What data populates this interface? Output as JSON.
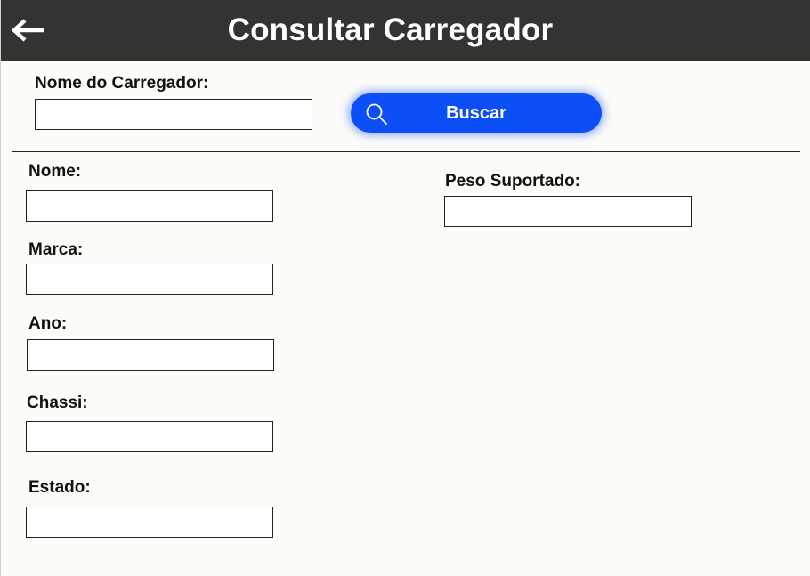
{
  "header": {
    "title": "Consultar Carregador",
    "back_icon": "arrow-left-icon"
  },
  "search": {
    "label": "Nome do Carregador:",
    "value": "",
    "button_label": "Buscar",
    "button_icon": "search-icon",
    "button_color": "#0c4ff6"
  },
  "details": {
    "nome": {
      "label": "Nome:",
      "value": ""
    },
    "marca": {
      "label": "Marca:",
      "value": ""
    },
    "ano": {
      "label": "Ano:",
      "value": ""
    },
    "chassi": {
      "label": "Chassi:",
      "value": ""
    },
    "estado": {
      "label": "Estado:",
      "value": ""
    },
    "peso_suportado": {
      "label": "Peso Suportado:",
      "value": ""
    }
  },
  "colors": {
    "header_bg": "#333331",
    "page_bg": "#fcfcf8",
    "accent": "#0c4ff6"
  }
}
